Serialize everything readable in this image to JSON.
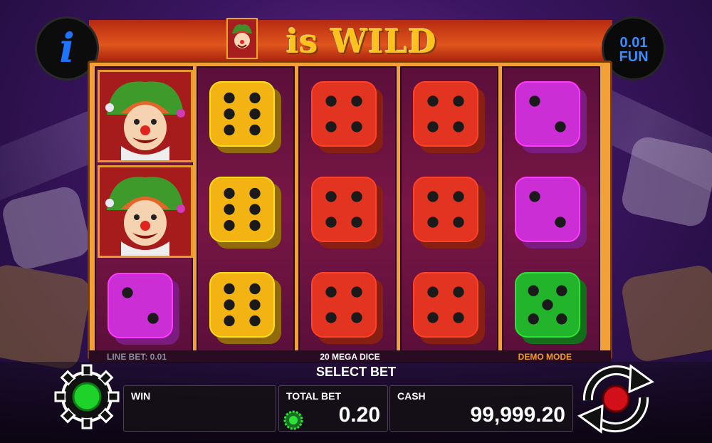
{
  "header": {
    "wild_text": "is WILD",
    "info_icon": "i",
    "denomination": "0.01",
    "currency": "FUN"
  },
  "reels": [
    [
      "joker",
      "joker",
      "dice-magenta-2"
    ],
    [
      "dice-yellow-6",
      "dice-yellow-6",
      "dice-yellow-6"
    ],
    [
      "dice-red-4",
      "dice-red-4",
      "dice-red-4"
    ],
    [
      "dice-red-4",
      "dice-red-4",
      "dice-red-4"
    ],
    [
      "dice-magenta-2",
      "dice-magenta-2",
      "dice-green-5"
    ]
  ],
  "status_strip": {
    "line_bet": "LINE BET: 0.01",
    "game_name": "20 MEGA DICE",
    "mode": "DEMO MODE"
  },
  "panel": {
    "select_bet": "SELECT BET",
    "win_label": "WIN",
    "win_value": "",
    "total_bet_label": "TOTAL BET",
    "total_bet_value": "0.20",
    "cash_label": "CASH",
    "cash_value": "99,999.20"
  },
  "icons": {
    "info": "info-icon",
    "settings": "gear-icon",
    "spin": "spin-arrows-icon",
    "coins": "coin-stack-icon"
  },
  "colors": {
    "yellow": "#f2b313",
    "red": "#e23420",
    "magenta": "#cc2ed6",
    "green": "#22b52c",
    "accent_orange": "#f39a21",
    "info_blue": "#1e74ff"
  }
}
